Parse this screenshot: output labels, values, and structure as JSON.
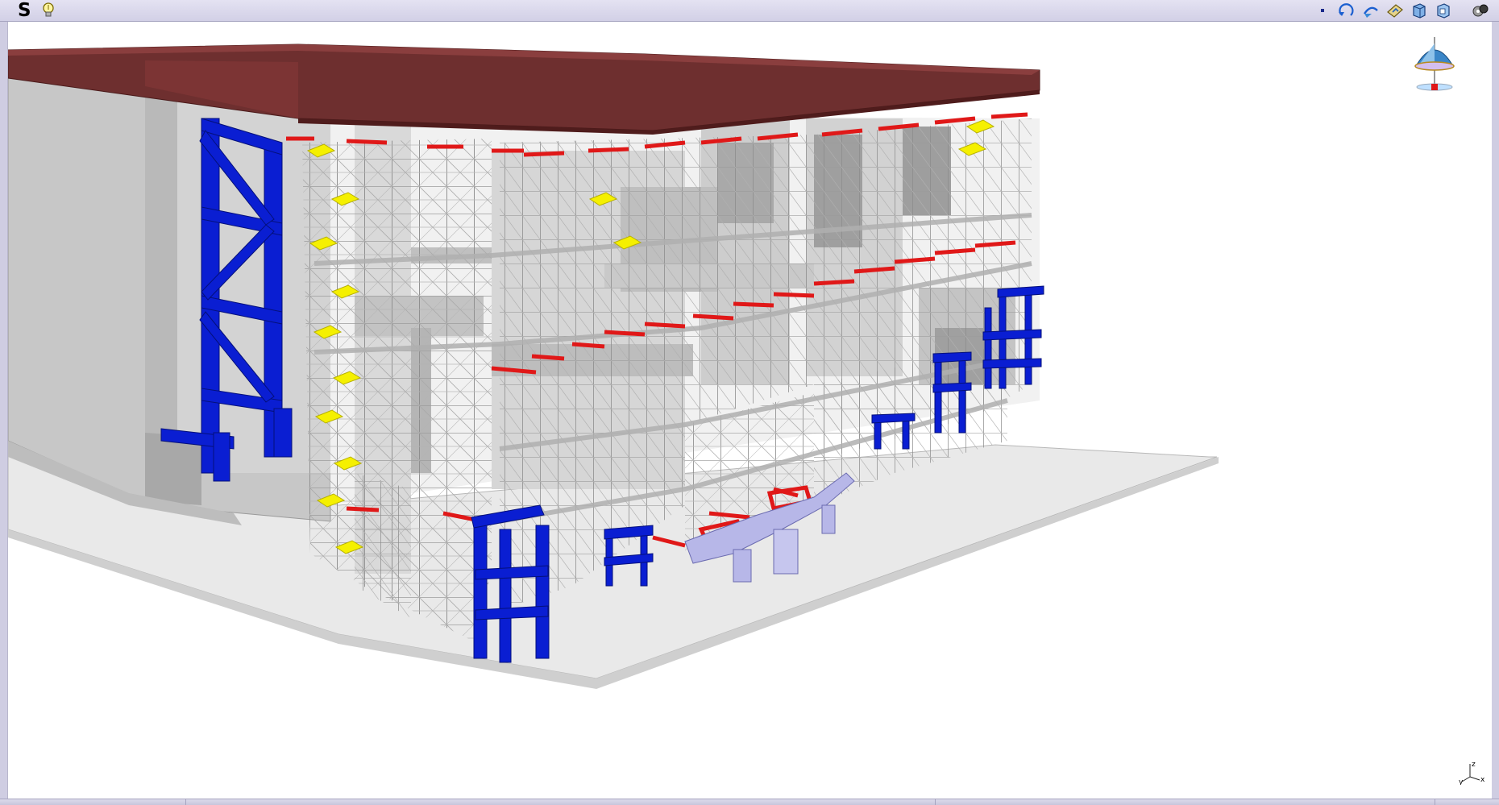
{
  "app": {
    "letter": "S"
  },
  "toolbar": {
    "icons": [
      "bulb-icon",
      "point-icon",
      "rotate-icon",
      "pan-icon",
      "fit-all-icon",
      "normal-view-icon",
      "multi-view-icon",
      "render-style-icon"
    ]
  },
  "axis": {
    "z": "z",
    "y": "y",
    "x": "x"
  },
  "colors": {
    "toolbar_bg": "#d8d6ea",
    "roof": "#6a2c2c",
    "structure_blue": "#0a1ed2",
    "scaffold": "#8c8c8c",
    "concrete": "#c8c8c8",
    "accent_red": "#e01818",
    "platform_yellow": "#f5f000",
    "lavender_part": "#b4b4e6"
  }
}
